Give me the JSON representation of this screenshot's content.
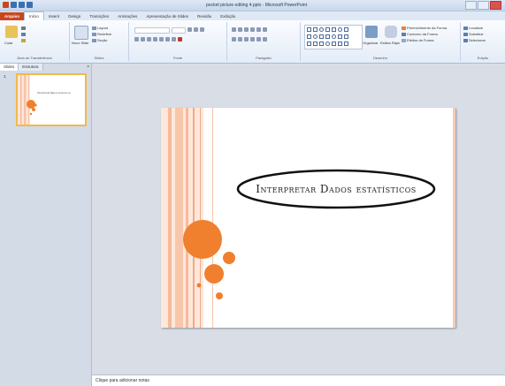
{
  "window": {
    "title": "pocket picture editing 4.pptx - Microsoft PowerPoint",
    "quick_access": [
      "save-icon",
      "undo-icon",
      "redo-icon"
    ]
  },
  "ribbon": {
    "tabs": [
      "Arquivo",
      "Início",
      "Inserir",
      "Design",
      "Transições",
      "Animações",
      "Apresentação de Slides",
      "Revisão",
      "Exibição"
    ],
    "active_tab": "Início",
    "groups": {
      "clipboard": {
        "label": "Área de Transferência",
        "paste": "Colar"
      },
      "slides": {
        "label": "Slides",
        "new_slide": "Novo Slide",
        "layout": "Layout",
        "reset": "Redefinir",
        "section": "Seção"
      },
      "font": {
        "label": "Fonte"
      },
      "paragraph": {
        "label": "Parágrafo"
      },
      "drawing": {
        "label": "Desenho",
        "arrange": "Organizar",
        "quick_styles": "Estilos Rápidos",
        "shape_fill": "Preenchimento da Forma",
        "shape_outline": "Contorno da Forma",
        "shape_effects": "Efeitos de Forma"
      },
      "editing": {
        "label": "Edição",
        "find": "Localizar",
        "replace": "Substituir",
        "select": "Selecionar"
      }
    }
  },
  "left_pane": {
    "tabs": [
      "Slides",
      "Estrutura"
    ],
    "close": "×",
    "slide_number": "1",
    "thumbnail_title": "Interpretar Dados estatísticos"
  },
  "slide": {
    "title": "Interpretar Dados estatísticos"
  },
  "notes": {
    "placeholder": "Clique para adicionar notas"
  },
  "colors": {
    "accent": "#f07f2e",
    "file_tab": "#c9461e",
    "stripe": "#f7c3a8",
    "canvas_bg": "#d9dee6"
  }
}
